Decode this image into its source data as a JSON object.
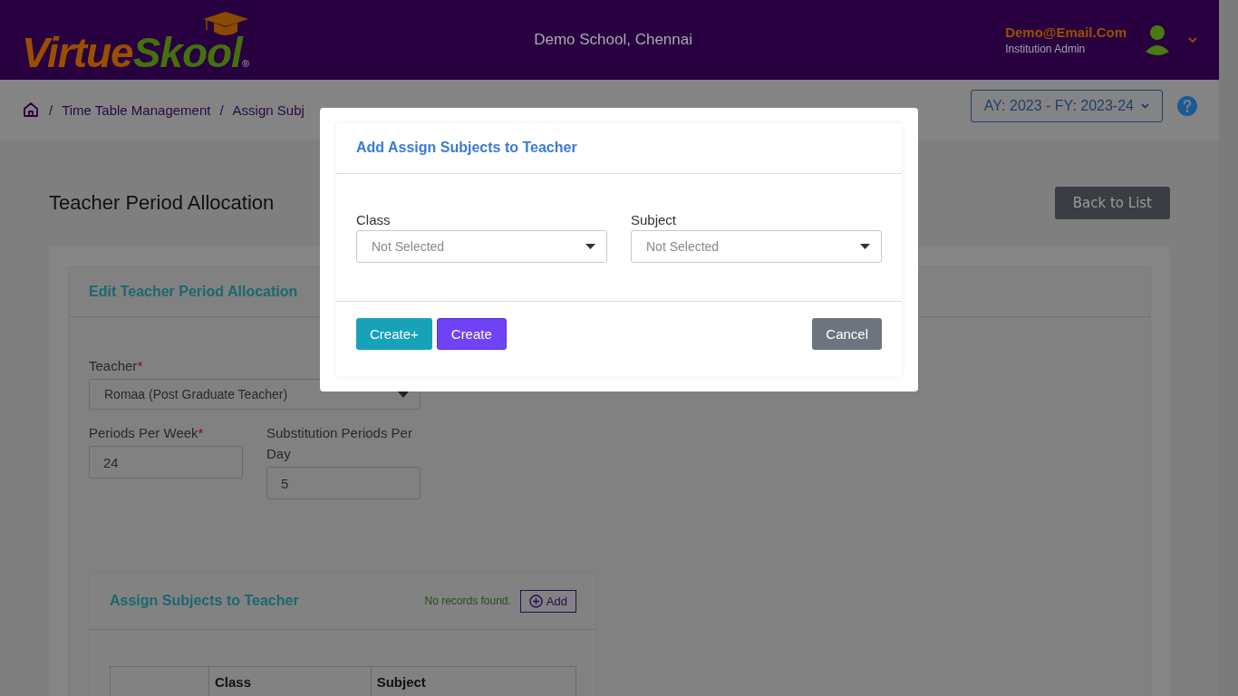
{
  "header": {
    "logo": {
      "part_1": "Virtue",
      "part_2": "Skool",
      "registered_mark": "®"
    },
    "school": "Demo School, Chennai",
    "user": {
      "email": "Demo@Email.Com",
      "role": "Institution Admin"
    }
  },
  "breadcrumb": [
    {
      "separator": "/",
      "label": "Time Table Management"
    },
    {
      "separator": "/",
      "label": "Assign Subj"
    }
  ],
  "year_selector": "AY: 2023 - FY: 2023-24",
  "page_title": "Teacher Period Allocation",
  "back_button": "Back to List",
  "form": {
    "title": "Edit Teacher Period Allocation",
    "fields": [
      {
        "label": "Teacher",
        "required_mark": "*",
        "value": "Romaa (Post Graduate Teacher)",
        "kind": "select"
      },
      {
        "label": "Periods Per Week",
        "required_mark": "*",
        "value": "24",
        "kind": "input"
      },
      {
        "label": "Substitution Periods Per Day",
        "value": "5",
        "kind": "input"
      }
    ]
  },
  "subjects_panel": {
    "title": "Assign Subjects to Teacher",
    "status": "No records found.",
    "add_button": "Add",
    "columns": [
      "Class",
      "Subject"
    ]
  },
  "modal": {
    "title": "Add Assign Subjects to Teacher",
    "fields": [
      {
        "label": "Class",
        "placeholder": "Not Selected"
      },
      {
        "label": "Subject",
        "placeholder": "Not Selected"
      }
    ],
    "buttons": [
      {
        "label": "Create+",
        "kind": "secondary"
      },
      {
        "label": "Create",
        "kind": "primary"
      },
      {
        "label": "Cancel",
        "kind": "cancel"
      }
    ]
  }
}
